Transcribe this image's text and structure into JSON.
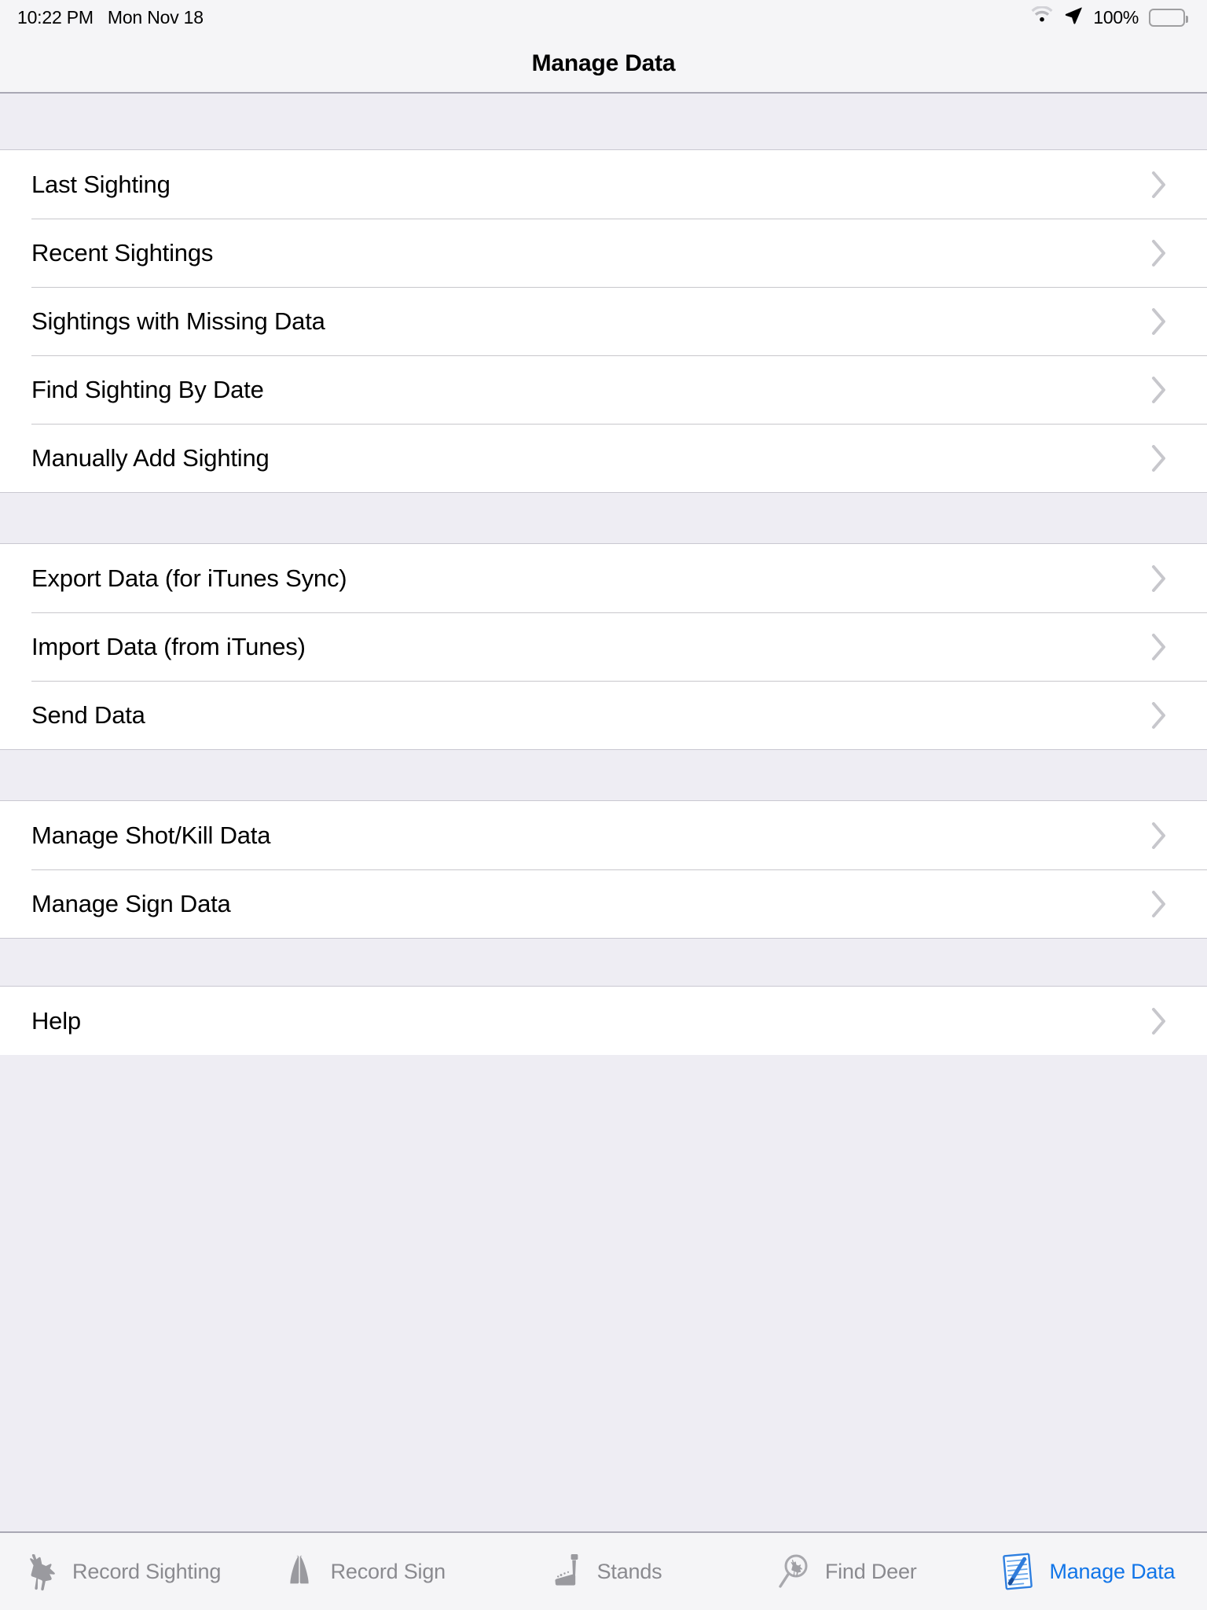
{
  "status_bar": {
    "time": "10:22 PM",
    "date": "Mon Nov 18",
    "battery_percent": "100%",
    "wifi_icon": "wifi-icon",
    "location_icon": "location-arrow-icon",
    "battery_icon": "battery-full-icon"
  },
  "nav": {
    "title": "Manage Data"
  },
  "colors": {
    "accent_blue": "#1175E8",
    "group_background": "#EEEDF3",
    "bar_background": "#F5F5F7",
    "row_background": "#FFFFFF",
    "separator": "#C8C7CC",
    "chevron": "#C7C7CC",
    "inactive_tab": "#8A8A8F"
  },
  "sections": [
    {
      "id": "sightings",
      "rows": [
        {
          "label": "Last Sighting",
          "accessory": "chevron-right-icon"
        },
        {
          "label": "Recent Sightings",
          "accessory": "chevron-right-icon"
        },
        {
          "label": "Sightings with Missing Data",
          "accessory": "chevron-right-icon"
        },
        {
          "label": "Find Sighting By Date",
          "accessory": "chevron-right-icon"
        },
        {
          "label": "Manually Add Sighting",
          "accessory": "chevron-right-icon"
        }
      ]
    },
    {
      "id": "transfer",
      "rows": [
        {
          "label": "Export Data (for iTunes Sync)",
          "accessory": "chevron-right-icon"
        },
        {
          "label": "Import Data (from iTunes)",
          "accessory": "chevron-right-icon"
        },
        {
          "label": "Send Data",
          "accessory": "chevron-right-icon"
        }
      ]
    },
    {
      "id": "manage",
      "rows": [
        {
          "label": "Manage Shot/Kill Data",
          "accessory": "chevron-right-icon"
        },
        {
          "label": "Manage Sign Data",
          "accessory": "chevron-right-icon"
        }
      ]
    },
    {
      "id": "help",
      "rows": [
        {
          "label": "Help",
          "accessory": "chevron-right-icon"
        }
      ]
    }
  ],
  "tabs": [
    {
      "label": "Record Sighting",
      "icon": "deer-antler-icon",
      "active": false
    },
    {
      "label": "Record Sign",
      "icon": "hoof-print-icon",
      "active": false
    },
    {
      "label": "Stands",
      "icon": "tree-stand-icon",
      "active": false
    },
    {
      "label": "Find Deer",
      "icon": "magnifier-deer-icon",
      "active": false
    },
    {
      "label": "Manage Data",
      "icon": "document-pen-icon",
      "active": true
    }
  ]
}
